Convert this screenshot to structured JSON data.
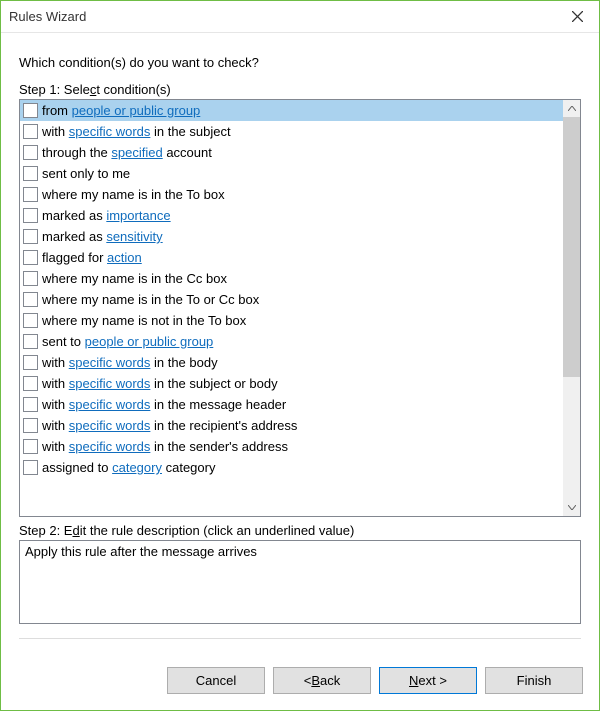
{
  "window": {
    "title": "Rules Wizard"
  },
  "wizard": {
    "question": "Which condition(s) do you want to check?",
    "step1_label": "Step 1: Select condition(s)",
    "step1_underline": "c",
    "step2_label": "Step 2: Edit the rule description (click an underlined value)",
    "step2_underline": "d"
  },
  "conditions": [
    {
      "selected": true,
      "parts": [
        {
          "t": "from "
        },
        {
          "t": "people or public group",
          "link": true
        }
      ]
    },
    {
      "selected": false,
      "parts": [
        {
          "t": "with "
        },
        {
          "t": "specific words",
          "link": true
        },
        {
          "t": " in the subject"
        }
      ]
    },
    {
      "selected": false,
      "parts": [
        {
          "t": "through the "
        },
        {
          "t": "specified",
          "link": true
        },
        {
          "t": " account"
        }
      ]
    },
    {
      "selected": false,
      "parts": [
        {
          "t": "sent only to me"
        }
      ]
    },
    {
      "selected": false,
      "parts": [
        {
          "t": "where my name is in the To box"
        }
      ]
    },
    {
      "selected": false,
      "parts": [
        {
          "t": "marked as "
        },
        {
          "t": "importance",
          "link": true
        }
      ]
    },
    {
      "selected": false,
      "parts": [
        {
          "t": "marked as "
        },
        {
          "t": "sensitivity",
          "link": true
        }
      ]
    },
    {
      "selected": false,
      "parts": [
        {
          "t": "flagged for "
        },
        {
          "t": "action",
          "link": true
        }
      ]
    },
    {
      "selected": false,
      "parts": [
        {
          "t": "where my name is in the Cc box"
        }
      ]
    },
    {
      "selected": false,
      "parts": [
        {
          "t": "where my name is in the To or Cc box"
        }
      ]
    },
    {
      "selected": false,
      "parts": [
        {
          "t": "where my name is not in the To box"
        }
      ]
    },
    {
      "selected": false,
      "parts": [
        {
          "t": "sent to "
        },
        {
          "t": "people or public group",
          "link": true
        }
      ]
    },
    {
      "selected": false,
      "parts": [
        {
          "t": "with "
        },
        {
          "t": "specific words",
          "link": true
        },
        {
          "t": " in the body"
        }
      ]
    },
    {
      "selected": false,
      "parts": [
        {
          "t": "with "
        },
        {
          "t": "specific words",
          "link": true
        },
        {
          "t": " in the subject or body"
        }
      ]
    },
    {
      "selected": false,
      "parts": [
        {
          "t": "with "
        },
        {
          "t": "specific words",
          "link": true
        },
        {
          "t": " in the message header"
        }
      ]
    },
    {
      "selected": false,
      "parts": [
        {
          "t": "with "
        },
        {
          "t": "specific words",
          "link": true
        },
        {
          "t": " in the recipient's address"
        }
      ]
    },
    {
      "selected": false,
      "parts": [
        {
          "t": "with "
        },
        {
          "t": "specific words",
          "link": true
        },
        {
          "t": " in the sender's address"
        }
      ]
    },
    {
      "selected": false,
      "parts": [
        {
          "t": "assigned to "
        },
        {
          "t": "category",
          "link": true
        },
        {
          "t": " category"
        }
      ]
    }
  ],
  "description": {
    "text": "Apply this rule after the message arrives"
  },
  "buttons": {
    "cancel": "Cancel",
    "back": "< Back",
    "back_underline": "B",
    "next": "Next >",
    "next_underline": "N",
    "finish": "Finish"
  }
}
